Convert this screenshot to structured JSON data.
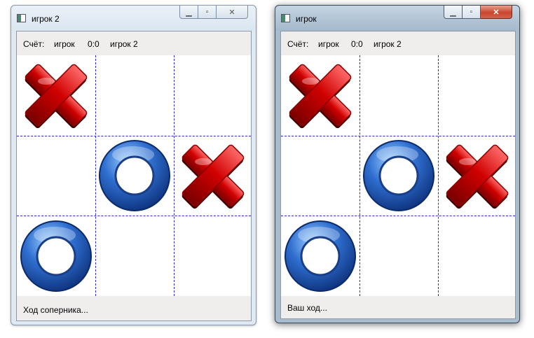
{
  "windows": [
    {
      "title": "игрок 2",
      "score": {
        "label": "Счёт:",
        "player1": "игрок",
        "value": "0:0",
        "player2": "игрок 2"
      },
      "board": [
        "X",
        "",
        "",
        "",
        "O",
        "X",
        "O",
        "",
        ""
      ],
      "status": "Ход соперника...",
      "active": false
    },
    {
      "title": "игрок",
      "score": {
        "label": "Счёт:",
        "player1": "игрок",
        "value": "0:0",
        "player2": "игрок 2"
      },
      "board": [
        "X",
        "",
        "",
        "",
        "O",
        "X",
        "O",
        "",
        ""
      ],
      "status": "Ваш ход...",
      "active": true
    }
  ],
  "icons": {
    "x": "red-x-mark-icon",
    "o": "blue-o-ring-icon"
  },
  "colors": {
    "grid": "#2a2ad8",
    "x_red": "#c00000",
    "o_blue": "#1b4ea8"
  }
}
